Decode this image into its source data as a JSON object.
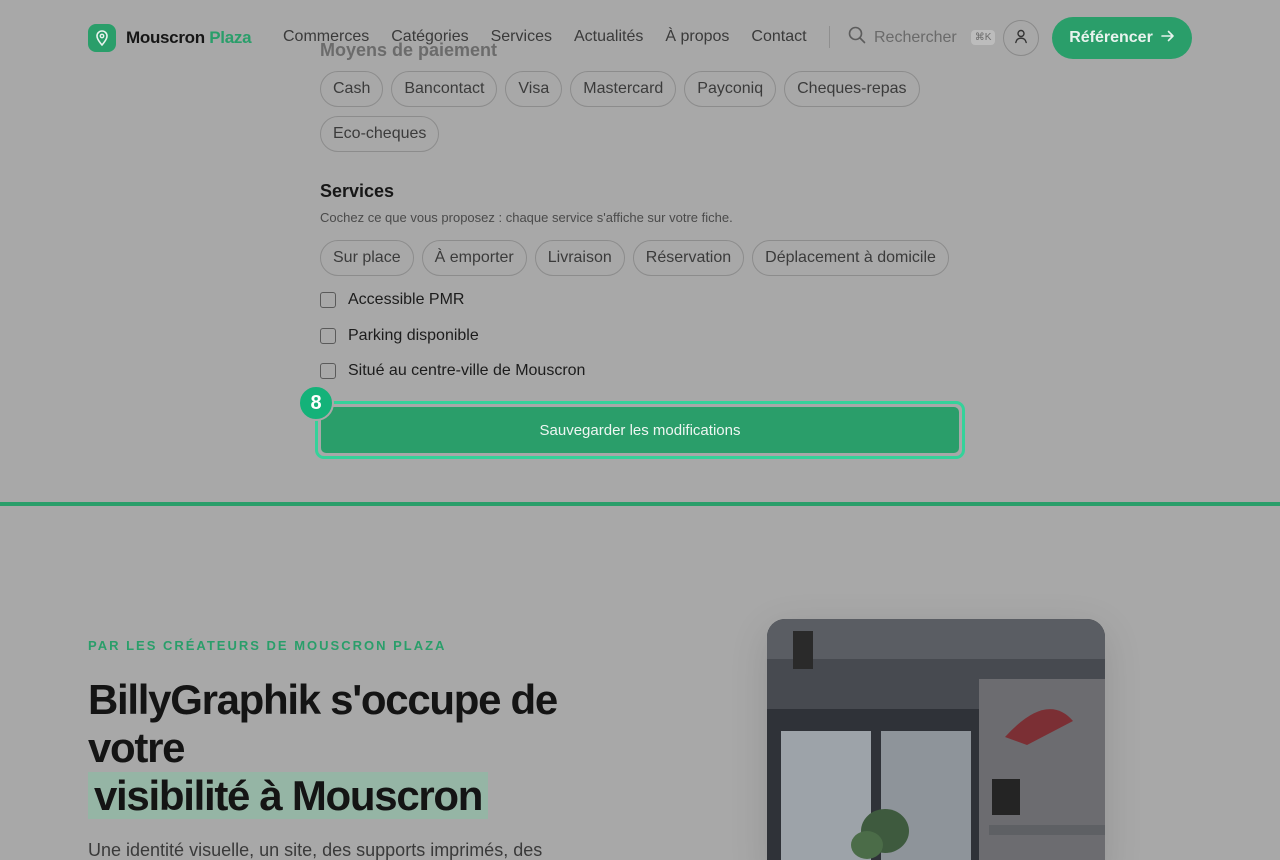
{
  "header": {
    "brand_part1": "Mouscron",
    "brand_part2": "Plaza",
    "nav": [
      "Commerces",
      "Catégories",
      "Services",
      "Actualités",
      "À propos",
      "Contact"
    ],
    "search_label": "Rechercher",
    "search_shortcut": "⌘K",
    "cta_label": "Référencer"
  },
  "form": {
    "payment_title": "Moyens de paiement",
    "payment_methods": [
      "Cash",
      "Bancontact",
      "Visa",
      "Mastercard",
      "Payconiq",
      "Cheques-repas",
      "Eco-cheques"
    ],
    "services_title": "Services",
    "services_hint": "Cochez ce que vous proposez : chaque service s'affiche sur votre fiche.",
    "services": [
      "Sur place",
      "À emporter",
      "Livraison",
      "Réservation",
      "Déplacement à domicile"
    ],
    "checkboxes": [
      {
        "label": "Accessible PMR",
        "checked": false
      },
      {
        "label": "Parking disponible",
        "checked": false
      },
      {
        "label": "Situé au centre-ville de Mouscron",
        "checked": false
      }
    ],
    "save_label": "Sauvegarder les modifications",
    "step_badge": "8"
  },
  "promo": {
    "eyebrow": "PAR LES CRÉATEURS DE MOUSCRON PLAZA",
    "headline_line1": "BillyGraphik s'occupe de votre",
    "headline_highlight": "visibilité à Mouscron",
    "lead": "Une identité visuelle, un site, des supports imprimés, des"
  },
  "colors": {
    "brand_green": "#2a9e6a",
    "highlight_ring": "#35d29a",
    "badge": "#14b279",
    "overlay_bg": "#a8a8a8"
  },
  "icons": {
    "logo": "map-pin-icon",
    "search": "search-icon",
    "user": "user-icon",
    "cta": "arrow-right-icon"
  }
}
